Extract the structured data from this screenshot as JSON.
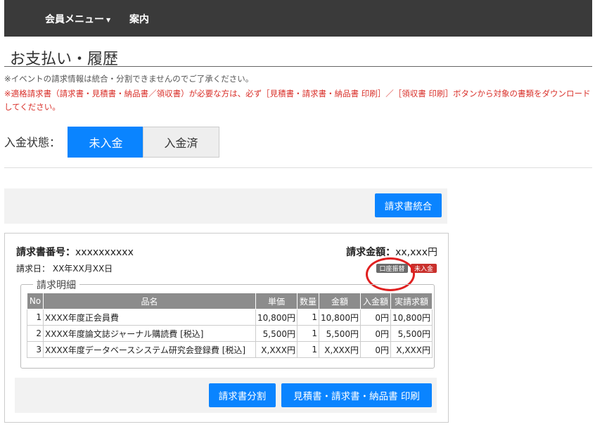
{
  "nav": {
    "member_menu": "会員メニュー",
    "guide": "案内"
  },
  "page": {
    "title": "お支払い・履歴",
    "note1": "※イベントの請求情報は統合・分割できませんのでご了承ください。",
    "note2": "※適格請求書（請求書・見積書・納品書／領収書）が必要な方は、必ず［見積書・請求書・納品書 印刷］／［領収書 印刷］ボタンから対象の書類をダウンロードしてください。"
  },
  "status_filter": {
    "label": "入金状態：",
    "options": [
      "未入金",
      "入金済"
    ],
    "selected": "未入金"
  },
  "actions": {
    "merge_button": "請求書統合",
    "split_button": "請求書分割",
    "print_button": "見積書・請求書・納品書 印刷"
  },
  "invoice": {
    "number_label": "請求書番号：",
    "number": "xxxxxxxxxx",
    "amount_label": "請求金額：",
    "amount": "xx,xxx円",
    "date_label": "請求日：",
    "date": "XX年XX月XX日",
    "payment_method_badge": "口座振替",
    "status_badge": "未入金",
    "detail_legend": "請求明細",
    "columns": [
      "No",
      "品名",
      "単価",
      "数量",
      "金額",
      "入金額",
      "実請求額"
    ],
    "rows": [
      [
        "1",
        "XXXX年度正会員費",
        "10,800円",
        "1",
        "10,800円",
        "0円",
        "10,800円"
      ],
      [
        "2",
        "XXXX年度論文誌ジャーナル購読費 [税込]",
        "5,500円",
        "1",
        "5,500円",
        "0円",
        "5,500円"
      ],
      [
        "3",
        "XXXX年度データベースシステム研究会登録費 [税込]",
        "X,XXX円",
        "1",
        "X,XXX円",
        "0円",
        "X,XXX円"
      ]
    ]
  },
  "colors": {
    "accent": "#0a84ff",
    "header_bg": "#3a3a3a",
    "warning_text": "#d9302a",
    "status_badge": "#c9302c",
    "method_badge": "#6b6b6b",
    "annotation_circle": "#e02020"
  }
}
